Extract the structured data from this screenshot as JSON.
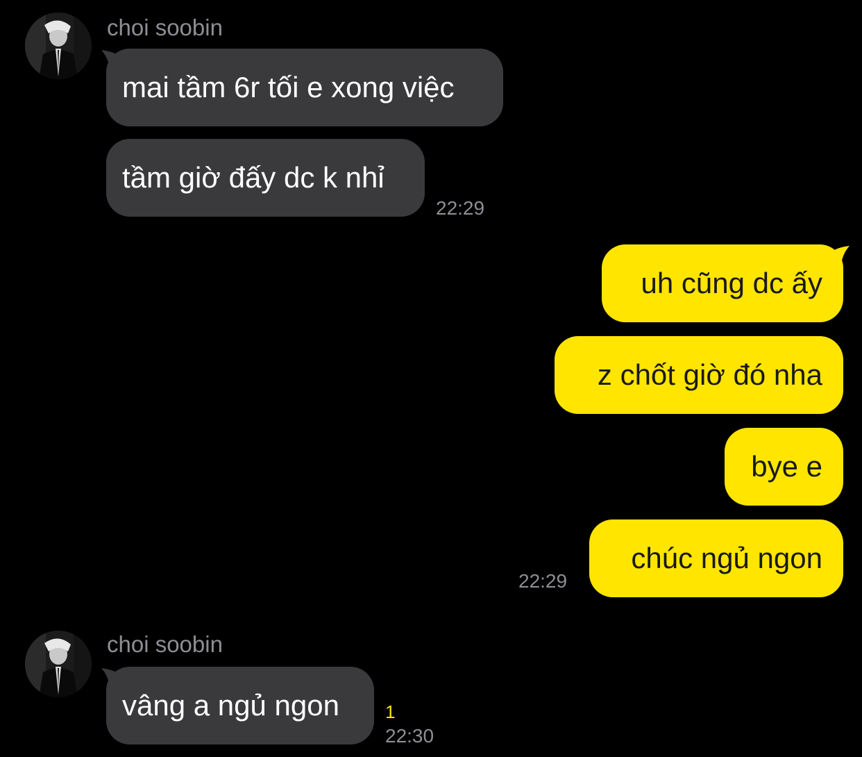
{
  "colors": {
    "background": "#000000",
    "incoming_bubble": "#3a3a3c",
    "outgoing_bubble": "#ffe500",
    "meta_text": "#8e8e93",
    "unread_count": "#ffe500"
  },
  "groups": [
    {
      "sender": "choi soobin",
      "avatar_icon": "profile-photo-icon",
      "messages": [
        "mai tầm 6r tối e xong việc",
        "tầm giờ đấy dc k nhỉ"
      ],
      "time": "22:29"
    },
    {
      "messages": [
        "uh cũng dc ấy",
        "z chốt giờ đó nha",
        "bye e",
        "chúc ngủ ngon"
      ],
      "time": "22:29"
    },
    {
      "sender": "choi soobin",
      "avatar_icon": "profile-photo-icon",
      "messages": [
        "vâng a ngủ ngon"
      ],
      "unread": "1",
      "time": "22:30"
    }
  ]
}
